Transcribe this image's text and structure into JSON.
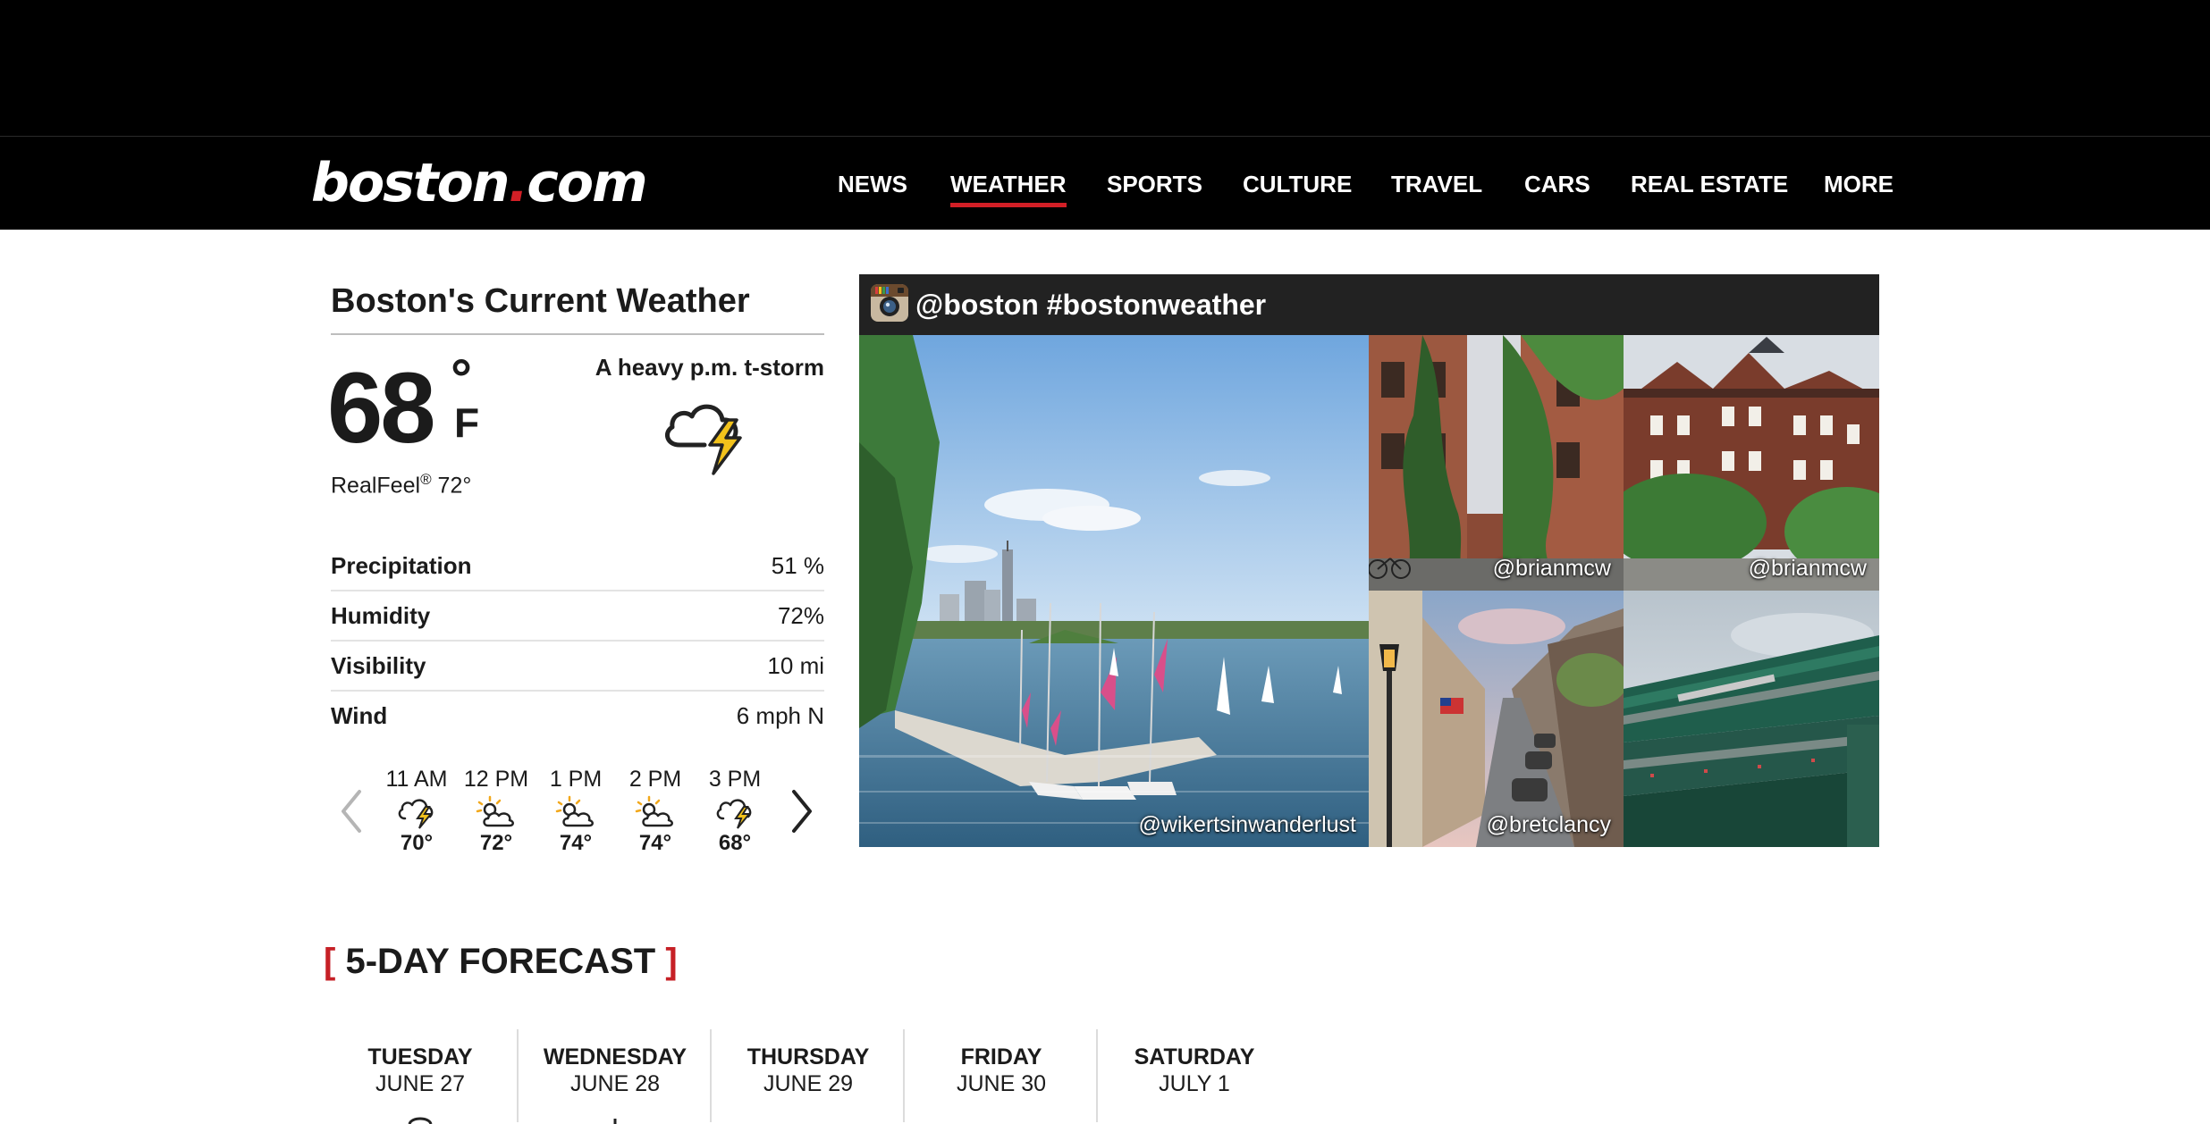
{
  "site": {
    "logo_main": "boston",
    "logo_dot": ".",
    "logo_tld": "com"
  },
  "nav": [
    {
      "label": "NEWS"
    },
    {
      "label": "WEATHER",
      "active": true
    },
    {
      "label": "SPORTS"
    },
    {
      "label": "CULTURE"
    },
    {
      "label": "TRAVEL"
    },
    {
      "label": "CARS"
    },
    {
      "label": "REAL ESTATE"
    },
    {
      "label": "MORE"
    }
  ],
  "current": {
    "title": "Boston's Current Weather",
    "temperature": "68",
    "degree": "°",
    "unit": "F",
    "realfeel_label": "RealFeel",
    "realfeel_mark": "®",
    "realfeel_value": "72°",
    "condition": "A heavy p.m. t-storm",
    "condition_icon": "thunderstorm-icon"
  },
  "stats": [
    {
      "label": "Precipitation",
      "value": "51 %"
    },
    {
      "label": "Humidity",
      "value": "72%"
    },
    {
      "label": "Visibility",
      "value": "10 mi"
    },
    {
      "label": "Wind",
      "value": "6 mph N"
    }
  ],
  "hourly": [
    {
      "time": "11 AM",
      "temp": "70°",
      "icon": "thunderstorm-icon"
    },
    {
      "time": "12 PM",
      "temp": "72°",
      "icon": "partly-sunny-icon"
    },
    {
      "time": "1 PM",
      "temp": "74°",
      "icon": "partly-sunny-icon"
    },
    {
      "time": "2 PM",
      "temp": "74°",
      "icon": "partly-sunny-icon"
    },
    {
      "time": "3 PM",
      "temp": "68°",
      "icon": "thunderstorm-icon"
    }
  ],
  "instagram": {
    "title": "@boston #bostonweather",
    "photos": [
      {
        "credit": "@wikertsinwanderlust",
        "subject": "charles-river-sailboats"
      },
      {
        "credit": "@brianmcw",
        "subject": "ivy-brownstone"
      },
      {
        "credit": "@brianmcw",
        "subject": "back-bay-brownstones"
      },
      {
        "credit": "@bretclancy",
        "subject": "beacon-hill-street"
      },
      {
        "credit": "",
        "subject": "fenway-park"
      }
    ]
  },
  "forecast": {
    "bracket_open": "[",
    "title": "5-DAY FORECAST",
    "bracket_close": "]",
    "days": [
      {
        "day": "TUESDAY",
        "date": "JUNE 27"
      },
      {
        "day": "WEDNESDAY",
        "date": "JUNE 28"
      },
      {
        "day": "THURSDAY",
        "date": "JUNE 29"
      },
      {
        "day": "FRIDAY",
        "date": "JUNE 30"
      },
      {
        "day": "SATURDAY",
        "date": "JULY 1"
      }
    ]
  },
  "colors": {
    "accent": "#d21f26",
    "bar": "#000000",
    "text": "#1b1b1b",
    "bolt": "#f2c21b"
  }
}
